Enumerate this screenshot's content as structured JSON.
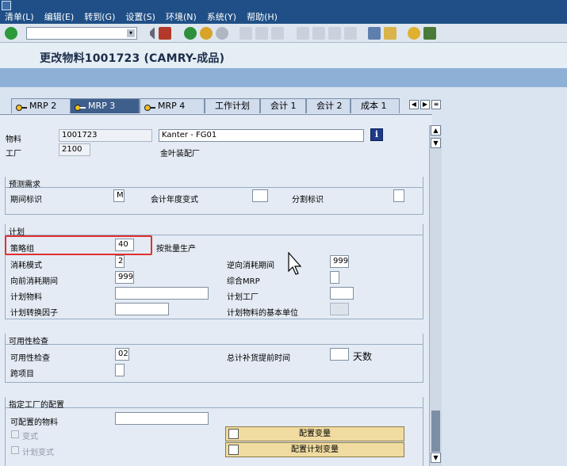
{
  "menu": [
    "清单(L)",
    "编辑(E)",
    "转到(G)",
    "设置(S)",
    "环境(N)",
    "系统(Y)",
    "帮助(H)"
  ],
  "toolbar": {
    "command_value": "",
    "icons": [
      "enter-icon",
      "save-icon",
      "back-icon",
      "exit-icon",
      "cancel-icon",
      "print-icon",
      "find-icon",
      "find-next-icon",
      "first-page-icon",
      "prev-page-icon",
      "next-page-icon",
      "last-page-icon",
      "new-session-icon",
      "shortcut-icon",
      "help-icon",
      "layout-icon"
    ]
  },
  "title": "更改物料1001723 (CAMRY-成品)",
  "tabs": [
    {
      "label": "MRP 2",
      "active": false,
      "icon": true
    },
    {
      "label": "MRP 3",
      "active": true,
      "icon": true
    },
    {
      "label": "MRP 4",
      "active": false,
      "icon": true
    },
    {
      "label": "工作计划",
      "active": false,
      "icon": false
    },
    {
      "label": "会计 1",
      "active": false,
      "icon": false
    },
    {
      "label": "会计 2",
      "active": false,
      "icon": false
    },
    {
      "label": "成本 1",
      "active": false,
      "icon": false
    }
  ],
  "header": {
    "material_label": "物料",
    "material_value": "1001723",
    "material_desc": "Kanter - FG01",
    "info_glyph": "i",
    "plant_label": "工厂",
    "plant_value": "2100",
    "plant_desc": "金叶装配厂"
  },
  "forecast": {
    "title": "预测需求",
    "period_label": "期间标识",
    "period_value": "M",
    "fiscal_label": "会计年度变式",
    "fiscal_value": "",
    "split_label": "分割标识",
    "split_value": ""
  },
  "planning": {
    "title": "计划",
    "strategy_label": "策略组",
    "strategy_value": "40",
    "strategy_desc": "按批量生产",
    "consumption_label": "消耗模式",
    "consumption_value": "2",
    "backward_label": "逆向消耗期间",
    "backward_value": "999",
    "forward_label": "向前消耗期间",
    "forward_value": "999",
    "mixed_label": "综合MRP",
    "mixed_value": "",
    "plan_material_label": "计划物料",
    "plan_material_value": "",
    "plan_plant_label": "计划工厂",
    "plan_plant_value": "",
    "conv_label": "计划转换因子",
    "conv_value": "",
    "base_unit_label": "计划物料的基本单位",
    "base_unit_value": ""
  },
  "availability": {
    "title": "可用性检查",
    "check_label": "可用性检查",
    "check_value": "02",
    "total_lead_label": "总计补货提前时间",
    "total_lead_value": "",
    "days_label": "天数",
    "cross_project_label": "跨项目",
    "cross_project_value": ""
  },
  "config": {
    "title": "指定工厂的配置",
    "configurable_label": "可配置的物料",
    "configurable_value": "",
    "variant_label": "变式",
    "plan_variant_label": "计划变式",
    "config_variant_button": "配置变量",
    "config_plan_variant_button": "配置计划变量"
  },
  "colors": {
    "menubar": "#1f4f86",
    "active_tab": "#3e5f8c",
    "highlight": "#e03030",
    "button": "#f0dba0"
  }
}
